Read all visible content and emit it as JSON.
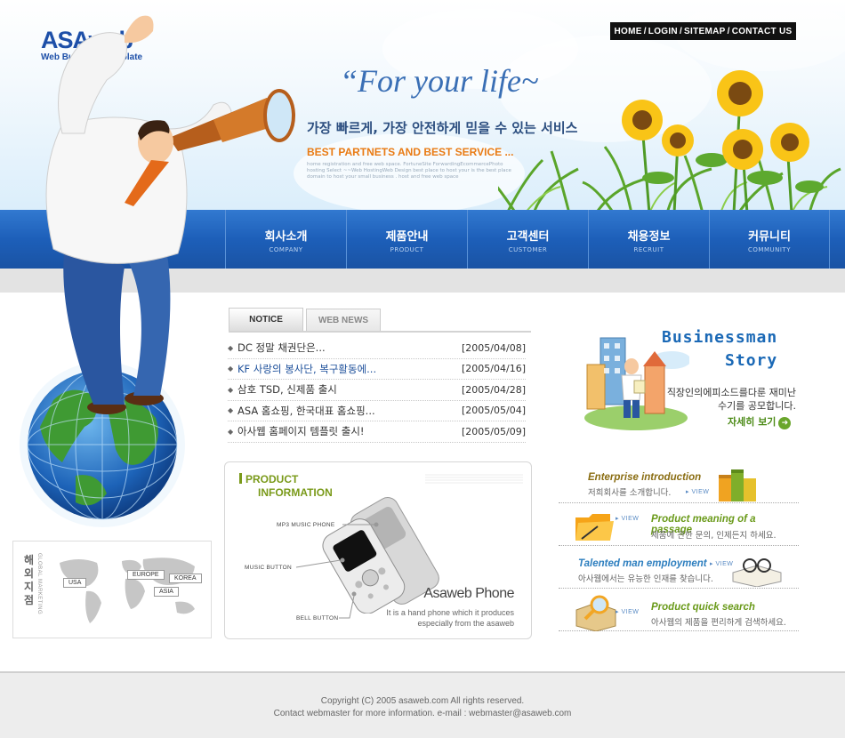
{
  "brand": {
    "name": "ASAweb",
    "subtitle": "Web Business Template"
  },
  "topnav": {
    "home": "HOME",
    "login": "LOGIN",
    "sitemap": "SITEMAP",
    "contact": "CONTACT US",
    "separator": "/"
  },
  "hero": {
    "slogan": "“For your life~",
    "slogan_kr": "가장 빠르게, 가장 안전하게 믿을 수 있는 서비스",
    "slogan_en": "BEST PARTNETS AND BEST SERVICE ...",
    "small_text": "home registration and free web space. FortuneSite ForwardingEcommercePhoto hosting Select ~~Web HostingWeb Design best place to host your is the best place domain to host your small business . host and free web space"
  },
  "mainnav": [
    {
      "kr": "회사소개",
      "en": "COMPANY"
    },
    {
      "kr": "제품안내",
      "en": "PRODUCT"
    },
    {
      "kr": "고객센터",
      "en": "CUSTOMER"
    },
    {
      "kr": "채용정보",
      "en": "RECRUIT"
    },
    {
      "kr": "커뮤니티",
      "en": "COMMUNITY"
    }
  ],
  "notice": {
    "tabs": [
      "NOTICE",
      "WEB NEWS"
    ],
    "items": [
      {
        "title": "DC 정말 채권단은...",
        "date": "[2005/04/08]"
      },
      {
        "title": "KF 사랑의 봉사단, 복구활동에...",
        "date": "[2005/04/16]"
      },
      {
        "title": "삼호 TSD, 신제품 출시",
        "date": "[2005/04/28]"
      },
      {
        "title": "ASA 홈쇼핑, 한국대표 홈쇼핑...",
        "date": "[2005/05/04]"
      },
      {
        "title": "아사웹 홈페이지 템플릿 출시!",
        "date": "[2005/05/09]"
      }
    ]
  },
  "product": {
    "title_line1": "PRODUCT",
    "title_line2": "INFORMATION",
    "callouts": {
      "mp3": "MP3 MUSIC PHONE",
      "music": "MUSIC BUTTON",
      "bell": "BELL BUTTON"
    },
    "name": "Asaweb Phone",
    "desc": "It is a hand phone which it produces especially from the asaweb"
  },
  "story": {
    "title1": "Businessman",
    "title2": "Story",
    "text": "직장인의에피소드를다룬 재미난 수기를 공모합니다.",
    "more": "자세히 보기"
  },
  "services": [
    {
      "title": "Enterprise introduction",
      "desc": "저희회사를 소개합니다.",
      "view": "VIEW",
      "color": "#8a6d12",
      "icon": "books-icon"
    },
    {
      "title": "Product meaning of a passage",
      "desc": "제품에 관한 문의, 인제든지 하세요.",
      "view": "VIEW",
      "color": "#6a9a1a",
      "icon": "folder-icon"
    },
    {
      "title": "Talented man employment",
      "desc": "아사웹에서는 유능한 인재를 찾습니다.",
      "view": "VIEW",
      "color": "#2e7fbf",
      "icon": "glasses-book-icon"
    },
    {
      "title": "Product quick search",
      "desc": "아사웹의 제품을 편리하게 검색하세요.",
      "view": "VIEW",
      "color": "#6a9a1a",
      "icon": "magnifier-box-icon"
    }
  ],
  "global": {
    "kr": "해외지점",
    "en": "GLOBAL MARKETING",
    "tags": [
      "USA",
      "EUROPE",
      "KOREA",
      "ASIA"
    ]
  },
  "footer": {
    "copyright": "Copyright (C) 2005 asaweb.com All rights reserved.",
    "contact": "Contact webmaster for more information.  e-mail : webmaster@asaweb.com"
  },
  "colors": {
    "nav_blue": "#1d5fb9",
    "brand_blue": "#1d4fa8",
    "accent_orange": "#e97b14",
    "green": "#6a9a1a"
  }
}
